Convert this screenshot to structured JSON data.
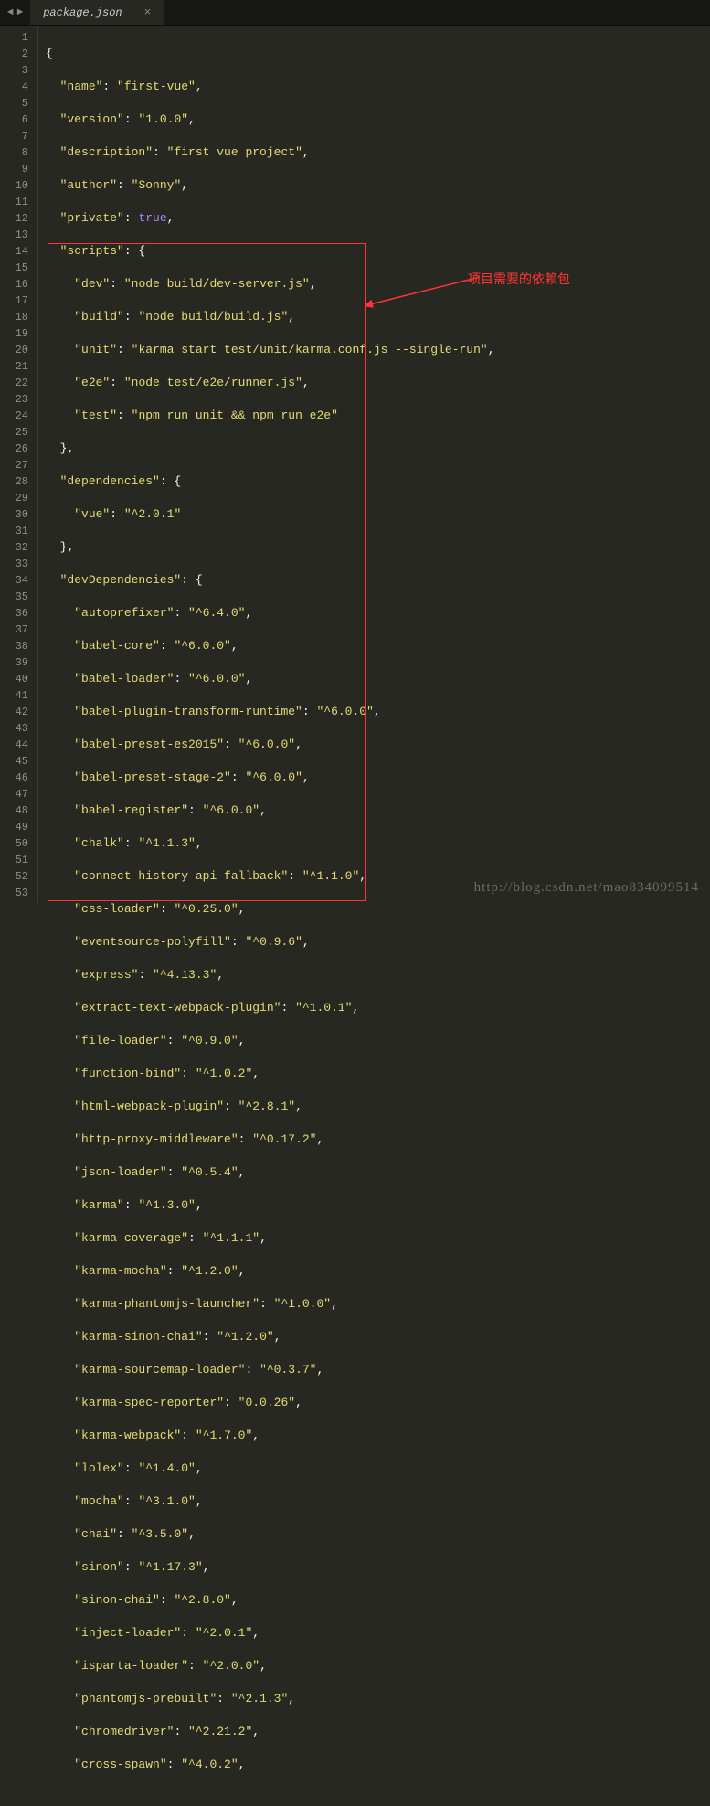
{
  "tab": {
    "name": "package.json",
    "close": "×"
  },
  "nav": {
    "back": "◄",
    "forward": "►"
  },
  "annotation": {
    "label": "项目需要的依赖包"
  },
  "watermark": "http://blog.csdn.net/mao834099514",
  "lines": [
    "1",
    "2",
    "3",
    "4",
    "5",
    "6",
    "7",
    "8",
    "9",
    "10",
    "11",
    "12",
    "13",
    "14",
    "15",
    "16",
    "17",
    "18",
    "19",
    "20",
    "21",
    "22",
    "23",
    "24",
    "25",
    "26",
    "27",
    "28",
    "29",
    "30",
    "31",
    "32",
    "33",
    "34",
    "35",
    "36",
    "37",
    "38",
    "39",
    "40",
    "41",
    "42",
    "43",
    "44",
    "45",
    "46",
    "47",
    "48",
    "49",
    "50",
    "51",
    "52",
    "53"
  ],
  "code": {
    "l1": "{",
    "l2_k": "\"name\"",
    "l2_v": "\"first-vue\"",
    "l3_k": "\"version\"",
    "l3_v": "\"1.0.0\"",
    "l4_k": "\"description\"",
    "l4_v": "\"first vue project\"",
    "l5_k": "\"author\"",
    "l5_v": "\"Sonny\"",
    "l6_k": "\"private\"",
    "l6_v": "true",
    "l7_k": "\"scripts\"",
    "l8_k": "\"dev\"",
    "l8_v": "\"node build/dev-server.js\"",
    "l9_k": "\"build\"",
    "l9_v": "\"node build/build.js\"",
    "l10_k": "\"unit\"",
    "l10_v": "\"karma start test/unit/karma.conf.js --single-run\"",
    "l11_k": "\"e2e\"",
    "l11_v": "\"node test/e2e/runner.js\"",
    "l12_k": "\"test\"",
    "l12_v": "\"npm run unit && npm run e2e\"",
    "l14_k": "\"dependencies\"",
    "l15_k": "\"vue\"",
    "l15_v": "\"^2.0.1\"",
    "l17_k": "\"devDependencies\"",
    "l18_k": "\"autoprefixer\"",
    "l18_v": "\"^6.4.0\"",
    "l19_k": "\"babel-core\"",
    "l19_v": "\"^6.0.0\"",
    "l20_k": "\"babel-loader\"",
    "l20_v": "\"^6.0.0\"",
    "l21_k": "\"babel-plugin-transform-runtime\"",
    "l21_v": "\"^6.0.0\"",
    "l22_k": "\"babel-preset-es2015\"",
    "l22_v": "\"^6.0.0\"",
    "l23_k": "\"babel-preset-stage-2\"",
    "l23_v": "\"^6.0.0\"",
    "l24_k": "\"babel-register\"",
    "l24_v": "\"^6.0.0\"",
    "l25_k": "\"chalk\"",
    "l25_v": "\"^1.1.3\"",
    "l26_k": "\"connect-history-api-fallback\"",
    "l26_v": "\"^1.1.0\"",
    "l27_k": "\"css-loader\"",
    "l27_v": "\"^0.25.0\"",
    "l28_k": "\"eventsource-polyfill\"",
    "l28_v": "\"^0.9.6\"",
    "l29_k": "\"express\"",
    "l29_v": "\"^4.13.3\"",
    "l30_k": "\"extract-text-webpack-plugin\"",
    "l30_v": "\"^1.0.1\"",
    "l31_k": "\"file-loader\"",
    "l31_v": "\"^0.9.0\"",
    "l32_k": "\"function-bind\"",
    "l32_v": "\"^1.0.2\"",
    "l33_k": "\"html-webpack-plugin\"",
    "l33_v": "\"^2.8.1\"",
    "l34_k": "\"http-proxy-middleware\"",
    "l34_v": "\"^0.17.2\"",
    "l35_k": "\"json-loader\"",
    "l35_v": "\"^0.5.4\"",
    "l36_k": "\"karma\"",
    "l36_v": "\"^1.3.0\"",
    "l37_k": "\"karma-coverage\"",
    "l37_v": "\"^1.1.1\"",
    "l38_k": "\"karma-mocha\"",
    "l38_v": "\"^1.2.0\"",
    "l39_k": "\"karma-phantomjs-launcher\"",
    "l39_v": "\"^1.0.0\"",
    "l40_k": "\"karma-sinon-chai\"",
    "l40_v": "\"^1.2.0\"",
    "l41_k": "\"karma-sourcemap-loader\"",
    "l41_v": "\"^0.3.7\"",
    "l42_k": "\"karma-spec-reporter\"",
    "l42_v": "\"0.0.26\"",
    "l43_k": "\"karma-webpack\"",
    "l43_v": "\"^1.7.0\"",
    "l44_k": "\"lolex\"",
    "l44_v": "\"^1.4.0\"",
    "l45_k": "\"mocha\"",
    "l45_v": "\"^3.1.0\"",
    "l46_k": "\"chai\"",
    "l46_v": "\"^3.5.0\"",
    "l47_k": "\"sinon\"",
    "l47_v": "\"^1.17.3\"",
    "l48_k": "\"sinon-chai\"",
    "l48_v": "\"^2.8.0\"",
    "l49_k": "\"inject-loader\"",
    "l49_v": "\"^2.0.1\"",
    "l50_k": "\"isparta-loader\"",
    "l50_v": "\"^2.0.0\"",
    "l51_k": "\"phantomjs-prebuilt\"",
    "l51_v": "\"^2.1.3\"",
    "l52_k": "\"chromedriver\"",
    "l52_v": "\"^2.21.2\"",
    "l53_k": "\"cross-spawn\"",
    "l53_v": "\"^4.0.2\""
  }
}
